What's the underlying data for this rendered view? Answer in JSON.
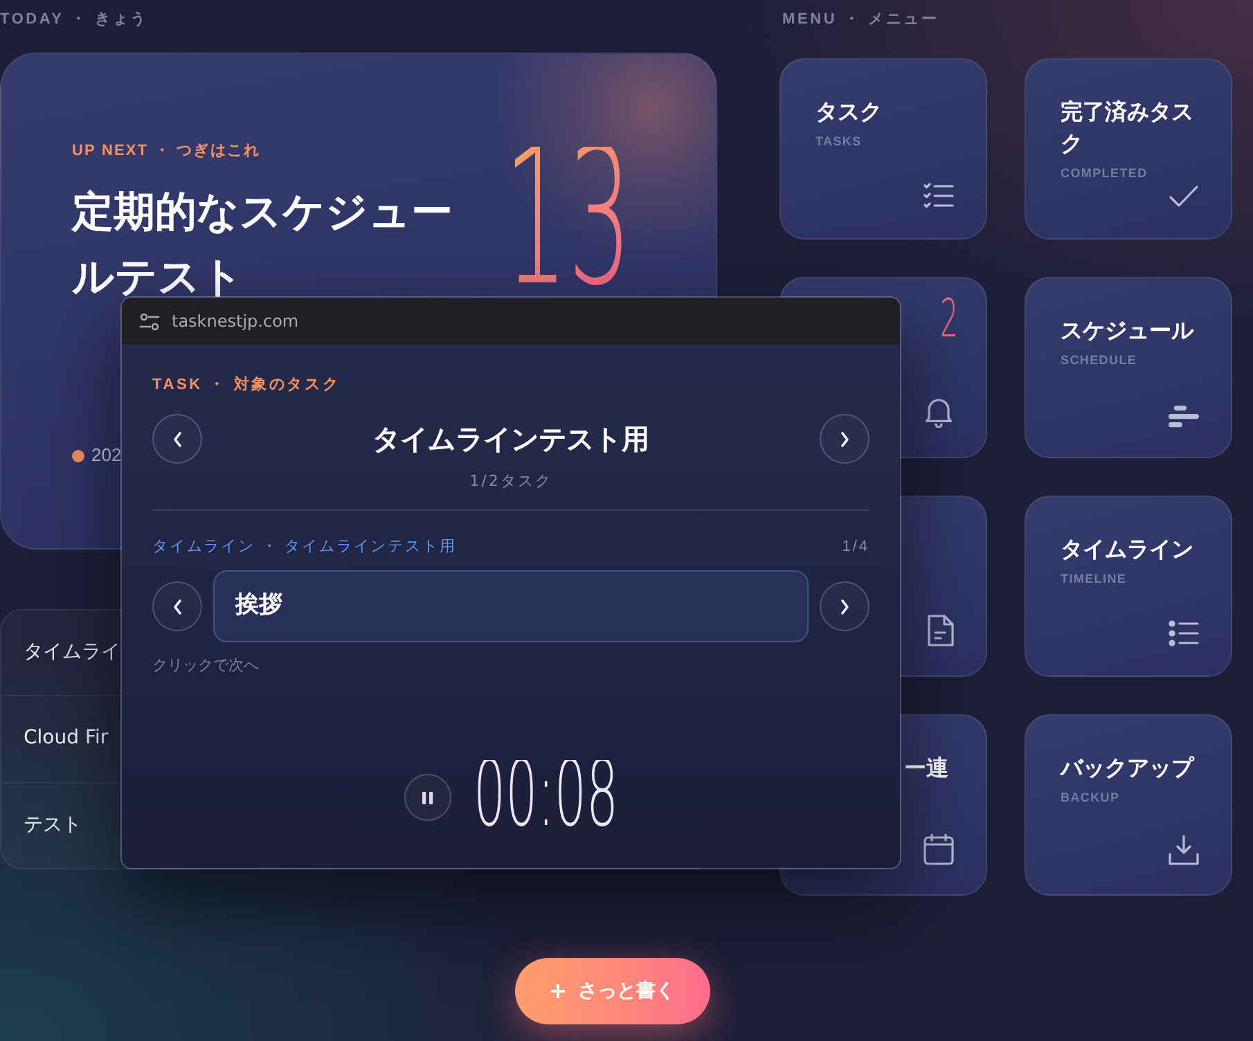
{
  "today": {
    "heading": "TODAY ・ きょう",
    "card": {
      "label": "UP NEXT ・ つぎはこれ",
      "title": "定期的なスケジュールテスト",
      "day": "13",
      "date": "202"
    },
    "list": [
      {
        "title": "タイムライ"
      },
      {
        "title": "Cloud Fir"
      },
      {
        "title": "テスト"
      }
    ]
  },
  "menu": {
    "heading": "MENU ・ メニュー",
    "items": [
      {
        "kind": "full",
        "title": "タスク",
        "subtitle": "TASKS"
      },
      {
        "kind": "full",
        "title": "完了済みタスク",
        "subtitle": "COMPLETED"
      },
      {
        "kind": "covered",
        "count": "2"
      },
      {
        "kind": "full",
        "title": "スケジュール",
        "subtitle": "SCHEDULE"
      },
      {
        "kind": "covered"
      },
      {
        "kind": "full",
        "title": "タイムライン",
        "subtitle": "TIMELINE"
      },
      {
        "kind": "clipped",
        "title": "ー連"
      },
      {
        "kind": "full",
        "title": "バックアップ",
        "subtitle": "BACKUP"
      }
    ]
  },
  "popup": {
    "address": "tasknestjp.com",
    "task_label": "TASK ・ 対象のタスク",
    "task_title": "タイムラインテスト用",
    "task_count": "1/2タスク",
    "step_label": "タイムライン ・ タイムラインテスト用",
    "step_count": "1/4",
    "step_text": "挨拶",
    "hint": "クリックで次へ",
    "timer": "00:08"
  },
  "quick_write_button": "さっと書く"
}
